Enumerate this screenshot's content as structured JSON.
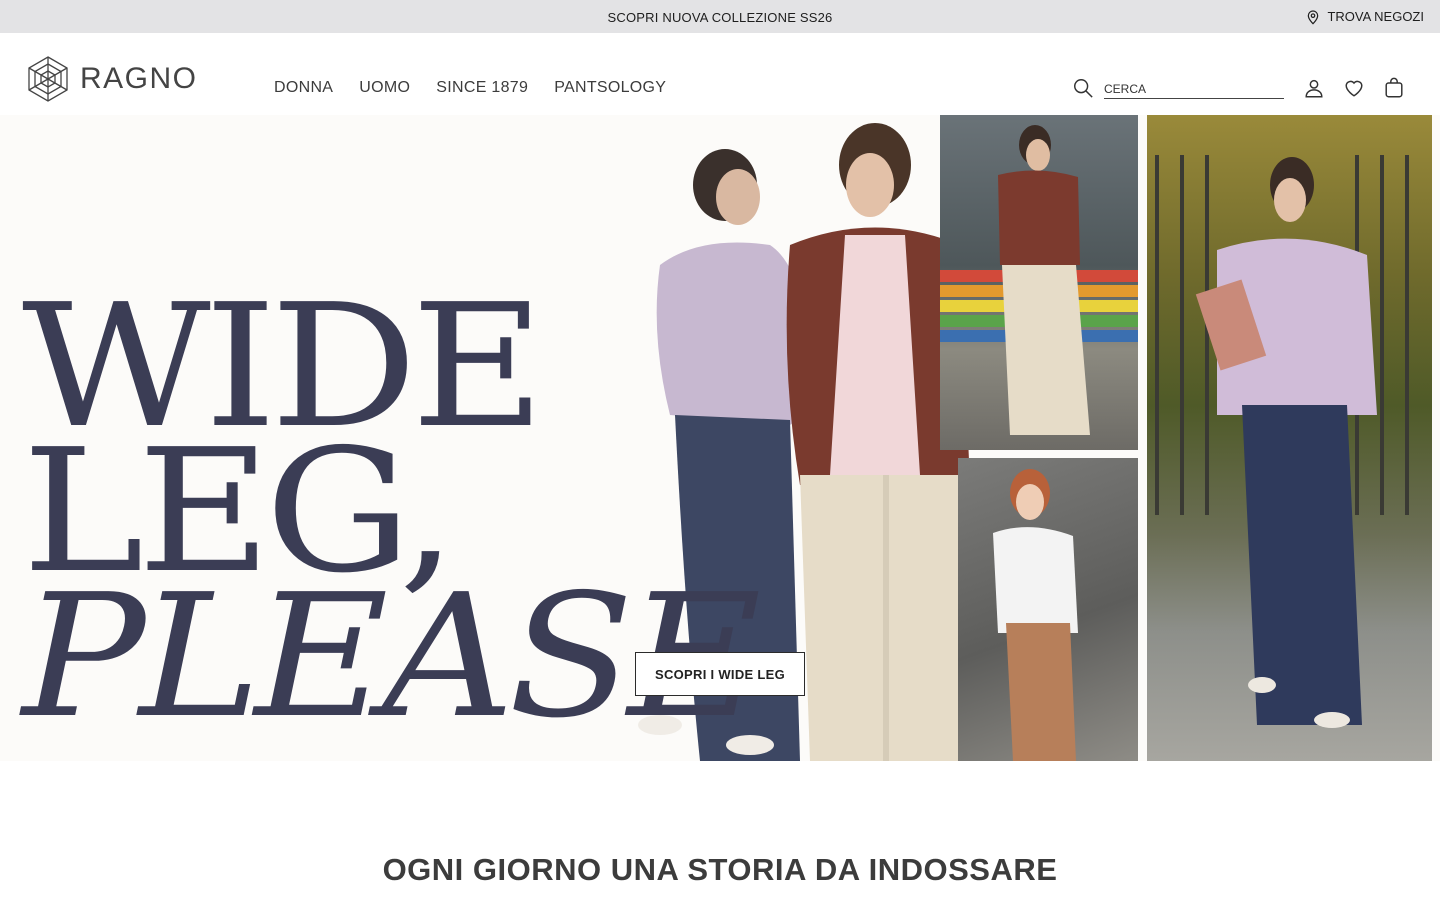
{
  "topbar": {
    "promo_text": "SCOPRI NUOVA COLLEZIONE SS26",
    "store_finder_label": "TROVA NEGOZI",
    "store_icon": "location-pin-icon"
  },
  "header": {
    "brand": "RAGNO",
    "logo_icon": "spider-web-icon",
    "nav": [
      {
        "label": "DONNA"
      },
      {
        "label": "UOMO"
      },
      {
        "label": "SINCE 1879"
      },
      {
        "label": "PANTSOLOGY"
      }
    ],
    "search": {
      "placeholder": "CERCA",
      "value": "",
      "icon": "search-icon"
    },
    "icons": [
      "user-icon",
      "heart-icon",
      "bag-icon"
    ]
  },
  "hero": {
    "headline_lines": [
      "WIDE",
      "LEG,",
      "PLEASE"
    ],
    "cta_label": "SCOPRI I WIDE LEG",
    "headline_color": "#3b3d55"
  },
  "section": {
    "title": "OGNI GIORNO UNA STORIA DA INDOSSARE"
  }
}
